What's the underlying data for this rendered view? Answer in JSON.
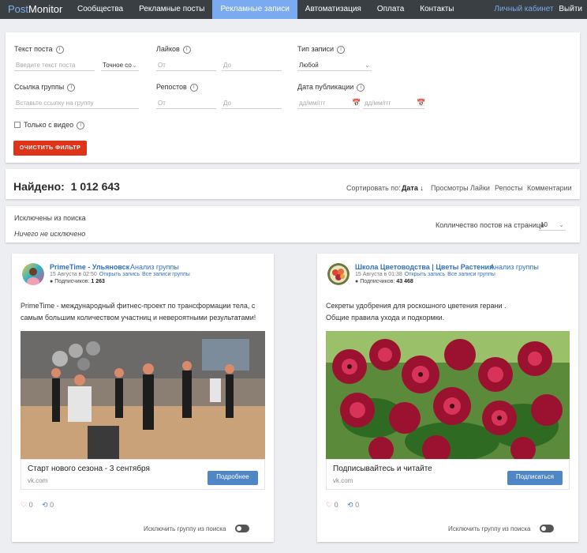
{
  "nav": {
    "logo_a": "Post",
    "logo_b": "Monitor",
    "items": [
      "Сообщества",
      "Рекламные посты",
      "Рекламные записи",
      "Автоматизация",
      "Оплата",
      "Контакты"
    ],
    "cabinet": "Личный кабинет",
    "logout": "Выйти"
  },
  "filters": {
    "post_text": {
      "label": "Текст поста",
      "placeholder": "Введите текст поста",
      "mode": "Точное со"
    },
    "likes": {
      "label": "Лайков",
      "from": "От",
      "to": "До"
    },
    "post_type": {
      "label": "Тип записи",
      "value": "Любой"
    },
    "group_link": {
      "label": "Ссылка группы",
      "placeholder": "Вставьте ссылку на группу"
    },
    "reposts": {
      "label": "Репостов",
      "from": "От",
      "to": "До"
    },
    "pub_date": {
      "label": "Дата публикации",
      "from": "дд/мм/ггг",
      "to": "дд/мм/ггг"
    },
    "video_only": "Только с видео",
    "clear": "ОЧИСТИТЬ ФИЛЬТР"
  },
  "results": {
    "found_label": "Найдено:",
    "found_count": "1 012 643",
    "sort_label": "Сортировать по:",
    "sort_date": "Дата ↓",
    "sort_views": "Просмотры",
    "sort_likes": "Лайки",
    "sort_reposts": "Репосты",
    "sort_comments": "Комментарии"
  },
  "excluded": {
    "title": "Исключены из поиска",
    "empty": "Ничего не исключено",
    "per_page_label": "Колличество постов на странице",
    "per_page_value": "10"
  },
  "posts": [
    {
      "group": "PrimeTime - Ульяновск",
      "analysis": "Анализ группы",
      "date": "15 Августа в 02:50",
      "open": "Открыть запись",
      "all": "Все записи группы",
      "subs_label": "Подписчиков:",
      "subs": "1 263",
      "text1": "PrimeTime - международный фитнес-проект по трансформации тела, с",
      "text2": "самым большим количеством участниц и невероятными результатами!",
      "link_title": "Старт нового сезона - 3 сентября",
      "link_domain": "vk.com",
      "button": "Подробнее",
      "likes": "0",
      "reposts": "0",
      "exclude": "Исключить группу из поиска"
    },
    {
      "group": "Школа Цветоводства | Цветы Растения",
      "analysis": "Анализ группы",
      "date": "15 Августа в 01:38",
      "open": "Открыть запись",
      "all": "Все записи группы",
      "subs_label": "Подписчиков:",
      "subs": "43 468",
      "text1": "Секреты удобрения для роскошного цветения герани .",
      "text2": "Общие правила ухода и подкормки.",
      "link_title": "Подписывайтесь и читайте",
      "link_domain": "vk.com",
      "button": "Подписаться",
      "likes": "0",
      "reposts": "0",
      "exclude": "Исключить группу из поиска"
    }
  ],
  "colors": {
    "nav_bg": "#3a3f44",
    "nav_active": "#7aaaf0",
    "red": "#e0341a",
    "blue": "#4f86c6",
    "link": "#2e72c4"
  }
}
